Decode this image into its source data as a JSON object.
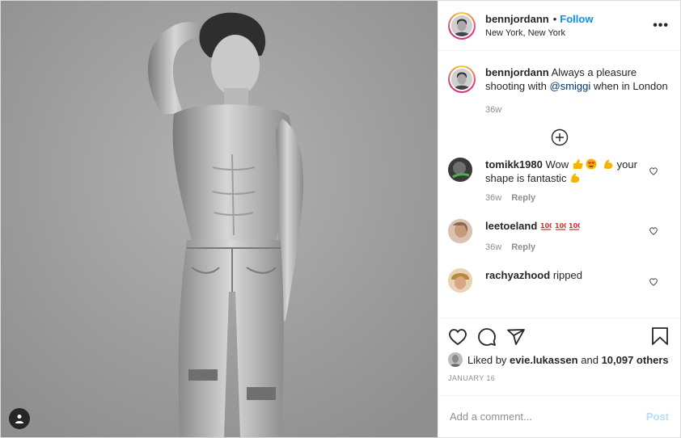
{
  "author": {
    "username": "bennjordann",
    "separator": "•",
    "follow_label": "Follow",
    "location": "New York, New York",
    "more_label": "•••"
  },
  "caption": {
    "username": "bennjordann",
    "text_before": "Always a pleasure shooting with",
    "mention": "@smiggi",
    "text_after": "when in London",
    "age": "36w"
  },
  "comments": [
    {
      "username": "tomikk1980",
      "text_before": "Wow",
      "text_middle": "your shape is fantastic",
      "age": "36w",
      "reply_label": "Reply"
    },
    {
      "username": "leetoeland",
      "age": "36w",
      "reply_label": "Reply"
    },
    {
      "username": "rachyazhood",
      "text": "ripped"
    }
  ],
  "likes": {
    "prefix": "Liked by",
    "user": "evie.lukassen",
    "conjunction": "and",
    "count": "10,097 others"
  },
  "post_date": "JANUARY 16",
  "add_comment": {
    "placeholder": "Add a comment...",
    "post_label": "Post"
  },
  "colors": {
    "accent": "#0095f6",
    "post_disabled": "#b2dffc",
    "muted": "#8e8e8e"
  }
}
